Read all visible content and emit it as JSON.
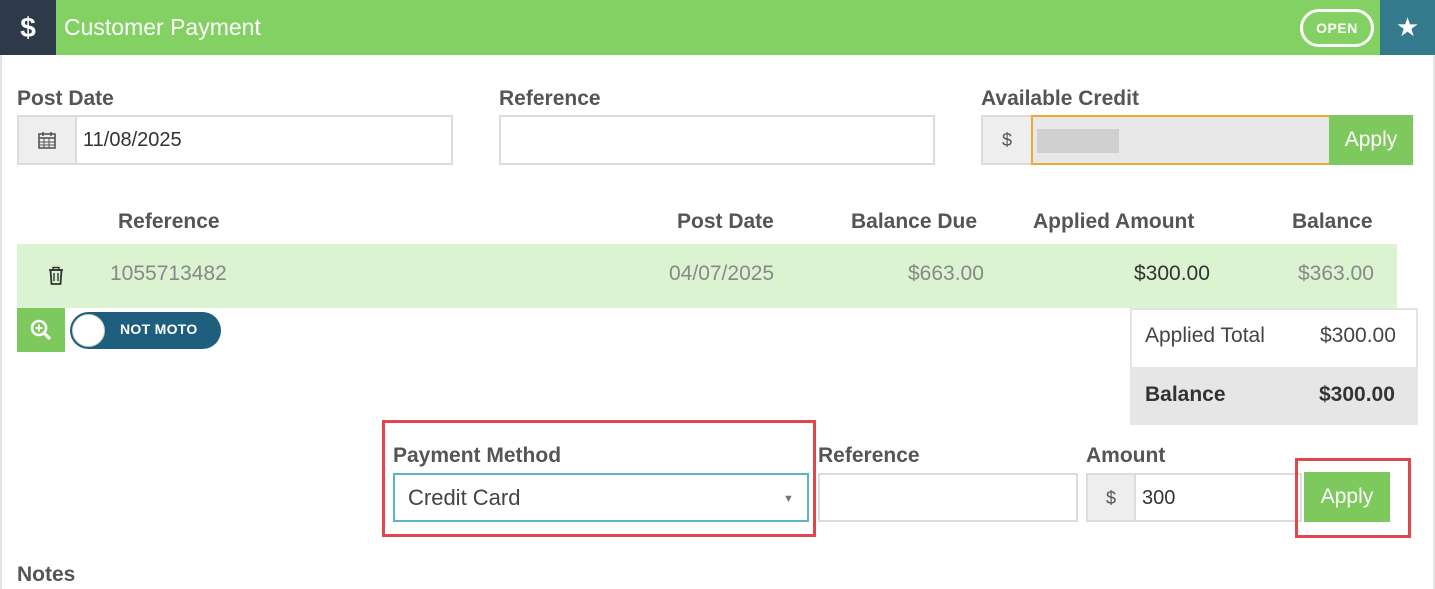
{
  "header": {
    "icon": "dollar-icon",
    "dollar_glyph": "$",
    "title": "Customer Payment",
    "status_badge": "OPEN",
    "star_icon": "star-icon"
  },
  "top_form": {
    "post_date_label": "Post Date",
    "post_date_value": "11/08/2025",
    "reference_label": "Reference",
    "reference_value": "",
    "available_credit_label": "Available Credit",
    "currency_symbol": "$",
    "available_credit_value": "",
    "apply_label": "Apply"
  },
  "table": {
    "headers": {
      "reference": "Reference",
      "post_date": "Post Date",
      "balance_due": "Balance Due",
      "applied_amount": "Applied Amount",
      "balance": "Balance"
    },
    "rows": [
      {
        "reference": "1055713482",
        "post_date": "04/07/2025",
        "balance_due": "$663.00",
        "applied_amount": "$300.00",
        "balance": "$363.00"
      }
    ]
  },
  "moto_toggle": {
    "label": "NOT MOTO",
    "state": "off"
  },
  "totals": {
    "applied_total_label": "Applied Total",
    "applied_total_value": "$300.00",
    "balance_label": "Balance",
    "balance_value": "$300.00"
  },
  "payment": {
    "method_label": "Payment Method",
    "method_value": "Credit Card",
    "reference_label": "Reference",
    "reference_value": "",
    "amount_label": "Amount",
    "currency_symbol": "$",
    "amount_value": "300",
    "apply_label": "Apply"
  },
  "notes_label": "Notes",
  "colors": {
    "header_green": "#84d163",
    "dark_navy": "#2e3a49",
    "teal": "#357a8c",
    "row_highlight": "#dbf3d0",
    "annotation_red": "#e0464b",
    "credit_border": "#f0a830"
  }
}
